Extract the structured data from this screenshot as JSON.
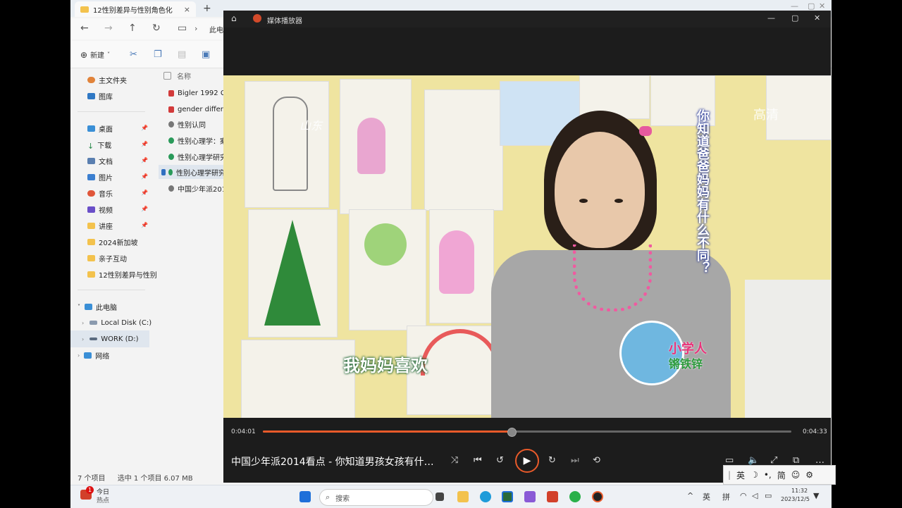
{
  "explorer": {
    "tab_title": "12性别差异与性别角色化",
    "tab_close": "×",
    "new_tab": "+",
    "breadcrumb": "此电",
    "new_button": "新建",
    "nav": {
      "home": "主文件夹",
      "gallery": "图库",
      "desktop": "桌面",
      "downloads": "下载",
      "documents": "文档",
      "pictures": "图片",
      "music": "音乐",
      "videos": "视频",
      "lectures": "讲座",
      "f2024": "2024新加坡",
      "parent": "亲子互动",
      "f12": "12性别差异与性别",
      "this_pc": "此电脑",
      "local_disk": "Local Disk (C:)",
      "work": "WORK (D:)",
      "network": "网络"
    },
    "column_name": "名称",
    "files": [
      "Bigler 1992 Co",
      "gender differen",
      "性别认同",
      "性别心理学：案",
      "性别心理学研究",
      "性别心理学研究",
      "中国少年派2014"
    ],
    "status_count": "7 个项目",
    "status_selected": "选中 1 个项目 6.07 MB"
  },
  "player": {
    "app_title": "媒体播放器",
    "video": {
      "channel": "山东",
      "hd": "高清",
      "vertical_caption": "你知道爸爸妈妈有什么不同？",
      "subtitle": "我妈妈喜欢",
      "logo_line1": "小学人",
      "logo_line2": "锵铁锌"
    },
    "time_elapsed": "0:04:01",
    "time_total": "0:04:33",
    "progress": 0.47,
    "now_playing": "中国少年派2014看点 - 你知道男孩女孩有什…"
  },
  "ime": {
    "lang": "英",
    "simp": "简"
  },
  "taskbar": {
    "news_line1": "今日",
    "news_line2": "热点",
    "badge": "1",
    "search_placeholder": "搜索",
    "ime_en": "英",
    "ime_pin": "拼",
    "time": "11:32",
    "date": "2023/12/5"
  },
  "colors": {
    "accent": "#e85a2a",
    "player_bg": "#1c1c1c"
  }
}
